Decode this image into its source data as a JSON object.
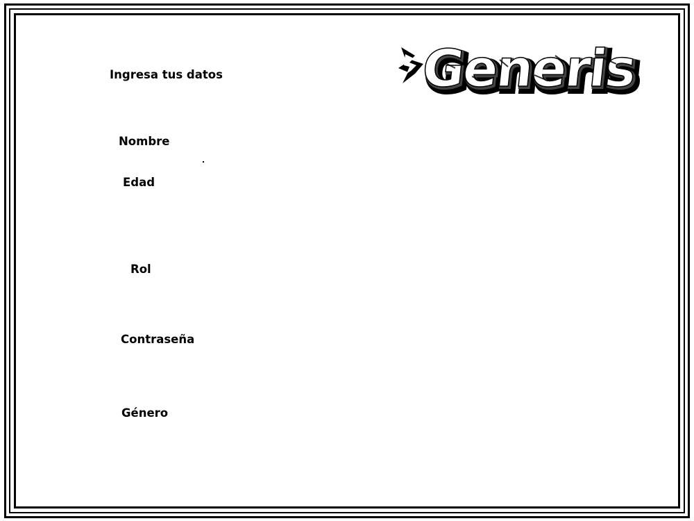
{
  "form": {
    "heading": "Ingresa tus datos",
    "fields": {
      "nombre": "Nombre",
      "edad": "Edad",
      "rol": "Rol",
      "contrasena": "Contraseña",
      "genero": "Género"
    }
  },
  "logo": {
    "text": "Generis"
  }
}
